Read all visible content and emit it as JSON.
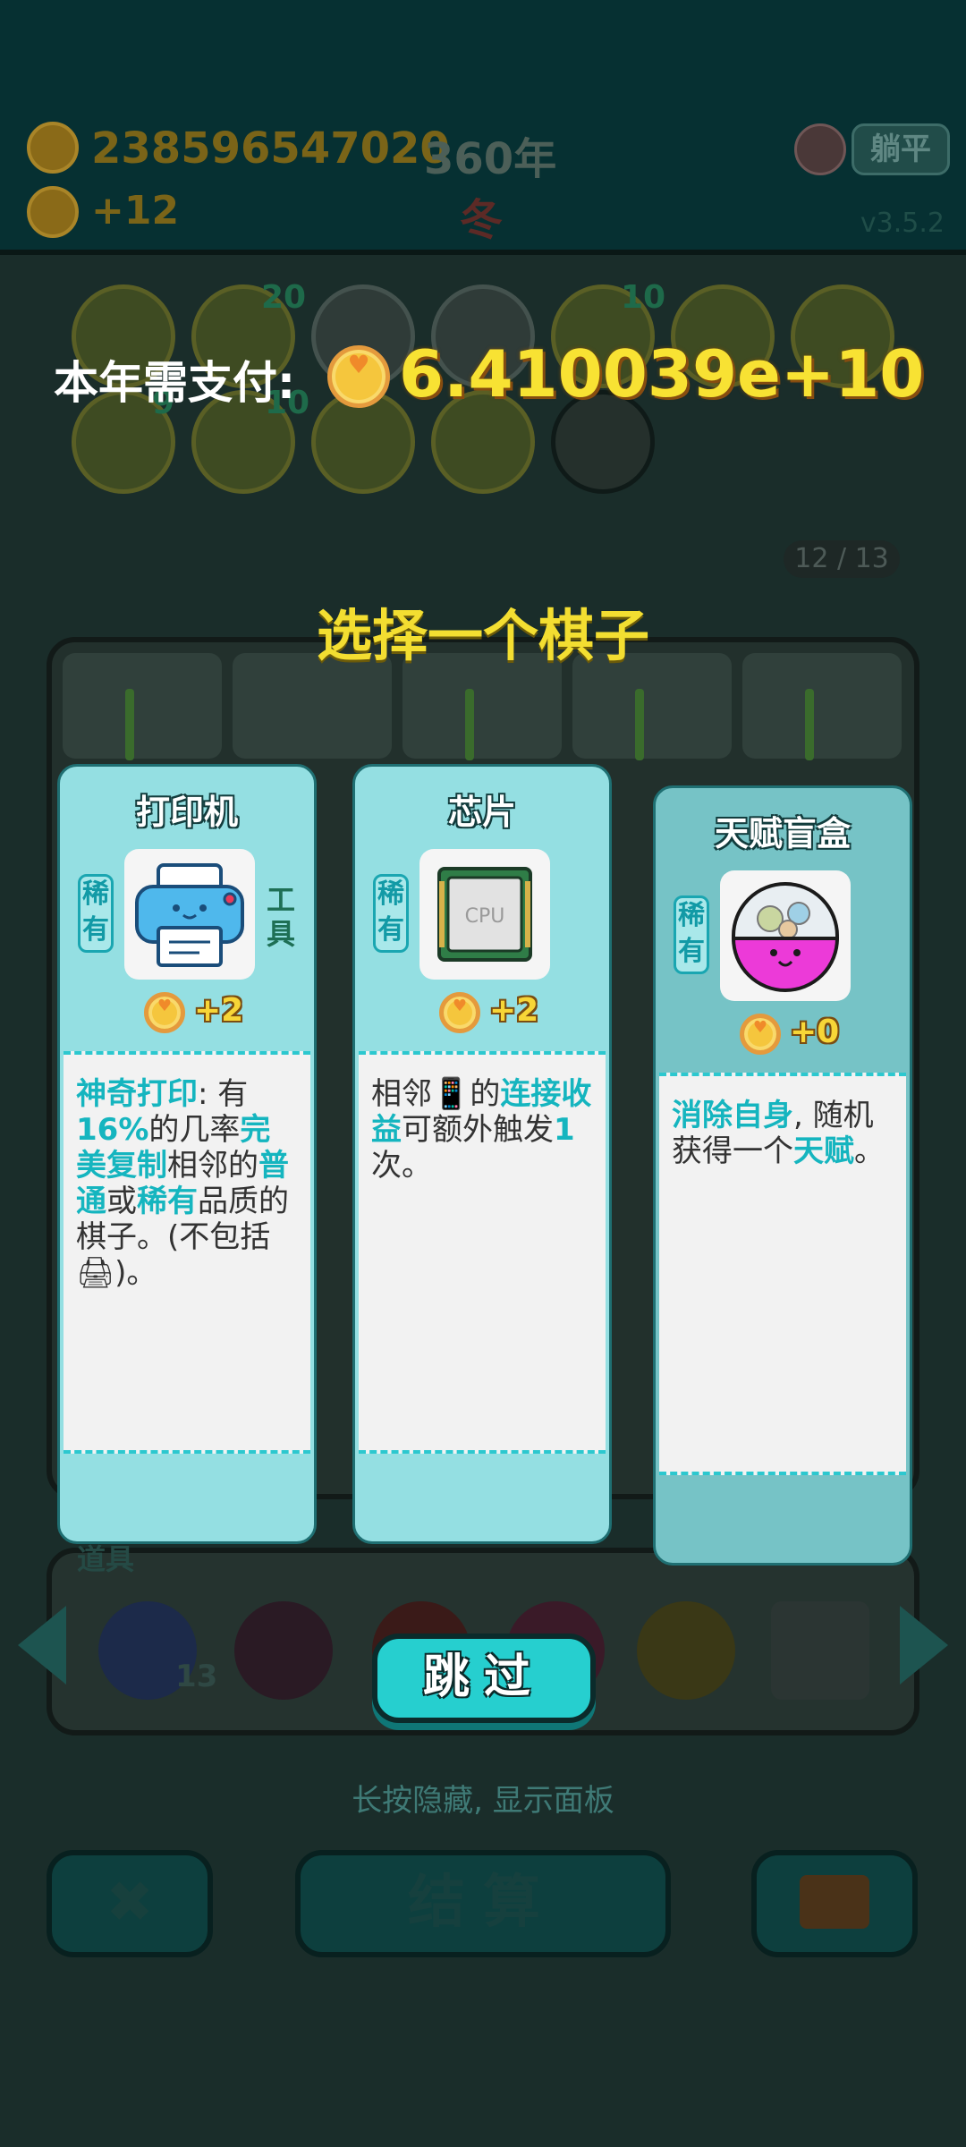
{
  "header": {
    "coins": "238596547020",
    "year": "360年",
    "income": "+12",
    "season": "冬",
    "lie_flat_label": "躺平",
    "version": "v3.5.2"
  },
  "board_bg": {
    "page_counter": "12 / 13",
    "icon_badges": [
      "20",
      "10",
      "9",
      "10"
    ],
    "item_count": "13"
  },
  "payment": {
    "label": "本年需支付:",
    "amount": "6.410039e+10"
  },
  "chooser": {
    "title": "选择一个棋子",
    "cards": [
      {
        "name": "打印机",
        "rarity": "稀有",
        "type": "工具",
        "bonus": "+2",
        "desc": [
          {
            "t": "神奇打印",
            "h": true
          },
          {
            "t": ": 有",
            "h": false
          },
          {
            "t": "16%",
            "h": true
          },
          {
            "t": "的几率",
            "h": false
          },
          {
            "t": "完美复制",
            "h": true
          },
          {
            "t": "相邻的",
            "h": false
          },
          {
            "t": "普通",
            "h": true
          },
          {
            "t": "或",
            "h": false
          },
          {
            "t": "稀有",
            "h": true
          },
          {
            "t": "品质的棋子。(不包括",
            "h": false
          },
          {
            "t": "🖨",
            "h": false
          },
          {
            "t": ")。",
            "h": false
          }
        ]
      },
      {
        "name": "芯片",
        "rarity": "稀有",
        "type": "",
        "bonus": "+2",
        "icon_label": "CPU",
        "desc": [
          {
            "t": "相邻",
            "h": false
          },
          {
            "t": "📱",
            "h": false
          },
          {
            "t": "的",
            "h": false
          },
          {
            "t": "连接收益",
            "h": true
          },
          {
            "t": "可额外触发",
            "h": false
          },
          {
            "t": "1",
            "h": true
          },
          {
            "t": "次。",
            "h": false
          }
        ]
      },
      {
        "name": "天赋盲盒",
        "rarity": "稀有",
        "type": "",
        "bonus": "+0",
        "desc": [
          {
            "t": "消除自身",
            "h": true
          },
          {
            "t": ", 随机获得一个",
            "h": false
          },
          {
            "t": "天赋",
            "h": true
          },
          {
            "t": "。",
            "h": false
          }
        ]
      }
    ],
    "skip_label": "跳过"
  },
  "footer": {
    "hint": "长按隐藏, 显示面板",
    "settle_label": "结算",
    "items_label": "道具"
  },
  "colors": {
    "accent": "#15b5bf",
    "gold": "#f8e233",
    "card_bg": "#94dfe2"
  }
}
